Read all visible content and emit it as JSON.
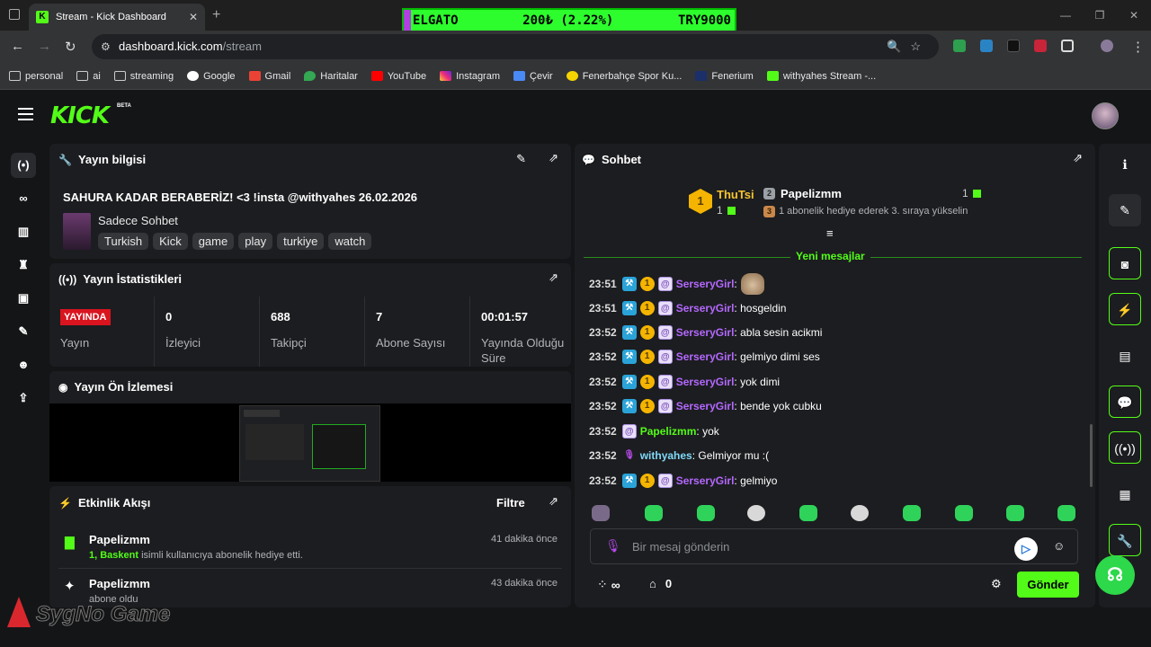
{
  "browser": {
    "tab_title": "Stream - Kick Dashboard",
    "url_host": "dashboard.kick.com",
    "url_path": "/stream",
    "ticker": {
      "symbol": "ELGATO",
      "change": "200₺ (2.22%)",
      "price": "TRY9000"
    },
    "bookmarks": [
      {
        "label": "personal",
        "icon": "folder-icon"
      },
      {
        "label": "ai",
        "icon": "folder-icon"
      },
      {
        "label": "streaming",
        "icon": "folder-icon"
      },
      {
        "label": "Google",
        "icon": "google-icon"
      },
      {
        "label": "Gmail",
        "icon": "gmail-icon"
      },
      {
        "label": "Haritalar",
        "icon": "maps-icon"
      },
      {
        "label": "YouTube",
        "icon": "youtube-icon"
      },
      {
        "label": "Instagram",
        "icon": "instagram-icon"
      },
      {
        "label": "Çevir",
        "icon": "translate-icon"
      },
      {
        "label": "Fenerbahçe Spor Ku...",
        "icon": "fenerbahce-icon"
      },
      {
        "label": "Fenerium",
        "icon": "fenerium-icon"
      },
      {
        "label": "withyahes Stream -...",
        "icon": "kick-icon"
      }
    ]
  },
  "header": {
    "logo": "KICK",
    "beta": "BETA"
  },
  "stream_info": {
    "title": "Yayın bilgisi",
    "stream_title": "SAHURA KADAR BERABERİZ! <3 !insta @withyahes 26.02.2026",
    "category": "Sadece Sohbet",
    "tags": [
      "Turkish",
      "Kick",
      "game",
      "play",
      "turkiye",
      "watch"
    ]
  },
  "stats": {
    "title": "Yayın İstatistikleri",
    "live_badge": "YAYINDA",
    "items": [
      {
        "value": "",
        "label": "Yayın"
      },
      {
        "value": "0",
        "label": "İzleyici"
      },
      {
        "value": "688",
        "label": "Takipçi"
      },
      {
        "value": "7",
        "label": "Abone Sayısı"
      },
      {
        "value": "00:01:57",
        "label": "Yayında Olduğu Süre"
      }
    ]
  },
  "preview": {
    "title": "Yayın Ön İzlemesi"
  },
  "activity": {
    "title": "Etkinlik Akışı",
    "filter": "Filtre",
    "events": [
      {
        "user": "Papelizmm",
        "highlight": "1, Baskent",
        "text": " isimli kullanıcıya abonelik hediye etti.",
        "time": "41 dakika önce"
      },
      {
        "user": "Papelizmm",
        "highlight": "",
        "text": "abone oldu",
        "time": "43 dakika önce"
      }
    ]
  },
  "chat": {
    "title": "Sohbet",
    "leader1": {
      "name": "ThuTsi",
      "count": "1",
      "rank": "1"
    },
    "leader2": {
      "name": "Papelizmm",
      "count": "1",
      "rank": "2",
      "note_rank": "3",
      "note": "1 abonelik hediye ederek 3. sıraya yükselin"
    },
    "new_messages": "Yeni mesajlar",
    "messages": [
      {
        "time": "23:51",
        "user": "SerseryGirl",
        "text": ":",
        "badges": "mod-sub-og"
      },
      {
        "time": "23:51",
        "user": "SerseryGirl",
        "text": ": hosgeldin",
        "badges": "mod-sub-og"
      },
      {
        "time": "23:52",
        "user": "SerseryGirl",
        "text": ": abla sesin acikmi",
        "badges": "mod-sub-og"
      },
      {
        "time": "23:52",
        "user": "SerseryGirl",
        "text": ": gelmiyo dimi ses",
        "badges": "mod-sub-og"
      },
      {
        "time": "23:52",
        "user": "SerseryGirl",
        "text": ": yok dimi",
        "badges": "mod-sub-og"
      },
      {
        "time": "23:52",
        "user": "SerseryGirl",
        "text": ": bende yok cubku",
        "badges": "mod-sub-og"
      },
      {
        "time": "23:52",
        "user": "Papelizmm",
        "text": ": yok",
        "badges": "og"
      },
      {
        "time": "23:52",
        "user": "withyahes",
        "text": ": Gelmiyor mu :(",
        "badges": "host"
      },
      {
        "time": "23:52",
        "user": "SerseryGirl",
        "text": ": gelmiyo",
        "badges": "mod-sub-og"
      }
    ],
    "input_placeholder": "Bir mesaj gönderin",
    "points": "∞",
    "store_count": "0",
    "send": "Gönder"
  },
  "watermark": "SygNo Game"
}
